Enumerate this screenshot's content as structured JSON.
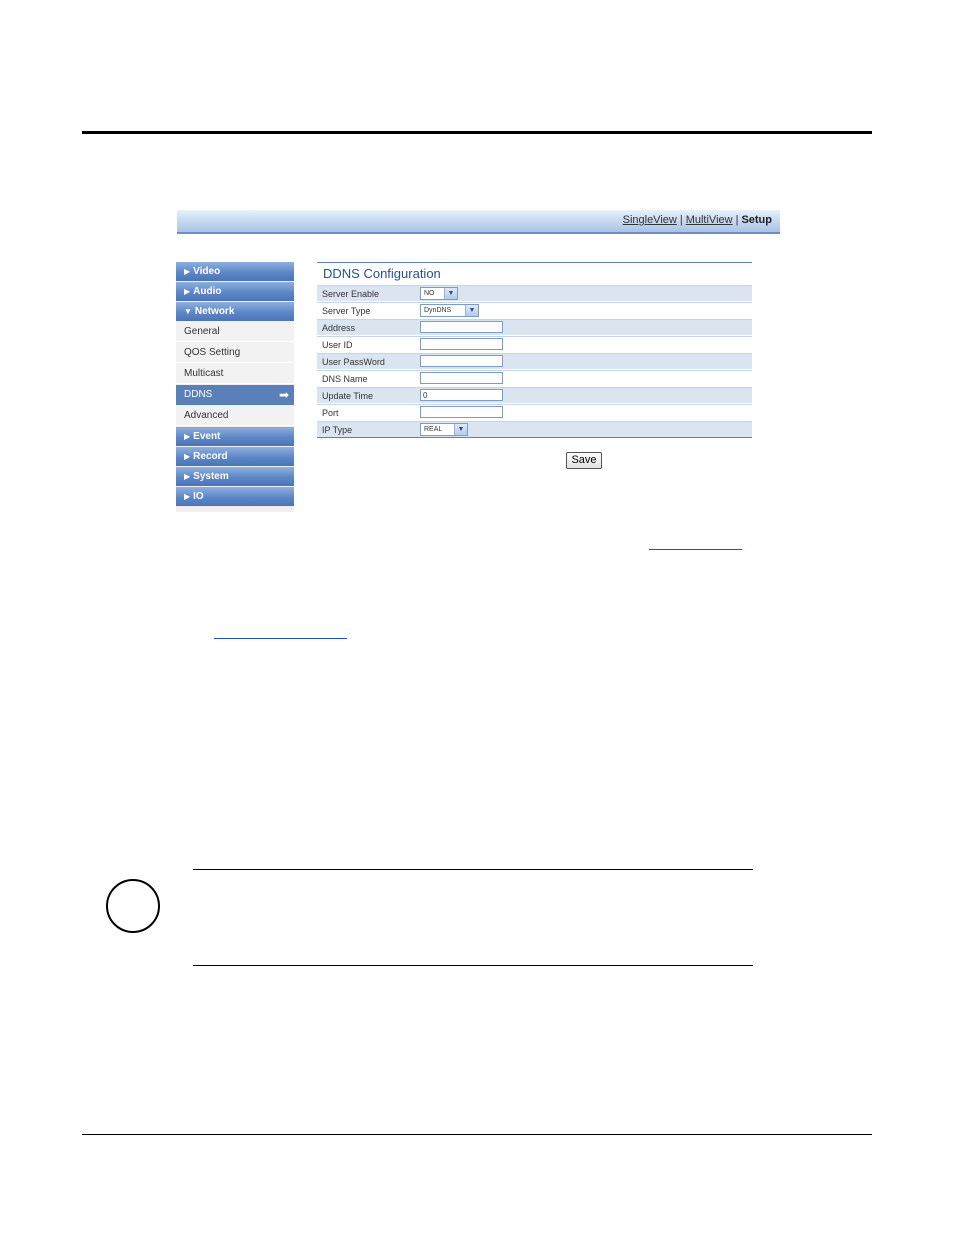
{
  "topbar": {
    "links": [
      "SingleView",
      "MultiView"
    ],
    "current": "Setup",
    "separator": "|"
  },
  "sidebar": {
    "items": [
      {
        "label": "Video",
        "type": "section",
        "icon": "triangle-right-icon"
      },
      {
        "label": "Audio",
        "type": "section",
        "icon": "triangle-right-icon"
      },
      {
        "label": "Network",
        "type": "section",
        "icon": "triangle-down-icon"
      },
      {
        "label": "General",
        "type": "sub"
      },
      {
        "label": "QOS Setting",
        "type": "sub"
      },
      {
        "label": "Multicast",
        "type": "sub"
      },
      {
        "label": "DDNS",
        "type": "active",
        "icon": "arrow-right-icon"
      },
      {
        "label": "Advanced",
        "type": "sub"
      },
      {
        "label": "Event",
        "type": "section",
        "icon": "triangle-right-icon"
      },
      {
        "label": "Record",
        "type": "section",
        "icon": "triangle-right-icon"
      },
      {
        "label": "System",
        "type": "section",
        "icon": "triangle-right-icon"
      },
      {
        "label": "IO",
        "type": "section",
        "icon": "triangle-right-icon"
      }
    ]
  },
  "form": {
    "title": "DDNS Configuration",
    "fields": {
      "server_enable": {
        "label": "Server Enable",
        "value": "NO"
      },
      "server_type": {
        "label": "Server Type",
        "value": "DynDNS"
      },
      "address": {
        "label": "Address",
        "value": ""
      },
      "user_id": {
        "label": "User ID",
        "value": ""
      },
      "user_password": {
        "label": "User PassWord",
        "value": ""
      },
      "dns_name": {
        "label": "DNS Name",
        "value": ""
      },
      "update_time": {
        "label": "Update Time",
        "value": "0"
      },
      "port": {
        "label": "Port",
        "value": ""
      },
      "ip_type": {
        "label": "IP Type",
        "value": "REAL"
      }
    },
    "save_label": "Save"
  },
  "colors": {
    "accent": "#5a7fb9",
    "title": "#2a4f8c",
    "row_shade": "#dbe4f1"
  }
}
